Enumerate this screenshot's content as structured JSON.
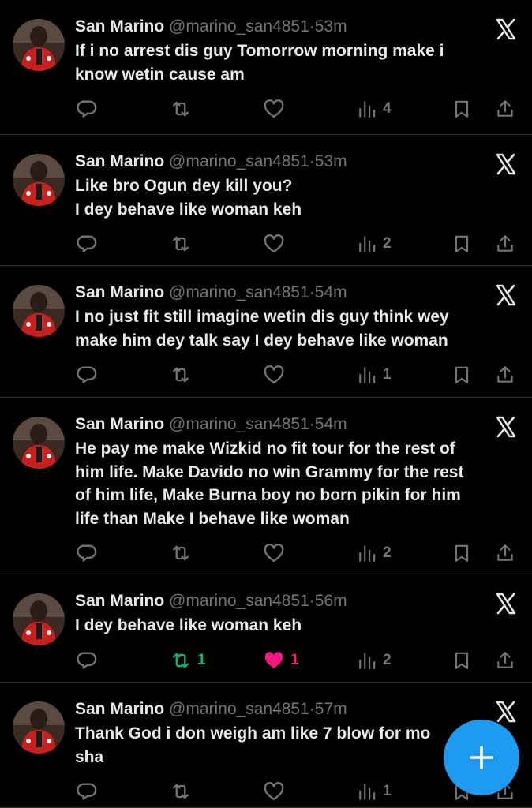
{
  "posts": [
    {
      "name": "San Marino",
      "handle": "@marino_san4851",
      "dot": "·",
      "time": "53m",
      "text": "If i no arrest dis guy Tomorrow morning make i\nknow wetin cause am",
      "reposts": "",
      "likes": "",
      "views": "4",
      "reposted": false,
      "liked": false
    },
    {
      "name": "San Marino",
      "handle": "@marino_san4851",
      "dot": "·",
      "time": "53m",
      "text": "Like bro Ogun dey kill you?\nI dey behave like woman keh",
      "reposts": "",
      "likes": "",
      "views": "2",
      "reposted": false,
      "liked": false
    },
    {
      "name": "San Marino",
      "handle": "@marino_san4851",
      "dot": "·",
      "time": "54m",
      "text": "I no just fit still imagine wetin dis guy think wey\nmake him dey talk say I dey behave like woman",
      "reposts": "",
      "likes": "",
      "views": "1",
      "reposted": false,
      "liked": false
    },
    {
      "name": "San Marino",
      "handle": "@marino_san4851",
      "dot": "·",
      "time": "54m",
      "text": "He pay me make Wizkid no fit tour for the rest of\nhim life. Make Davido no win Grammy for the rest\nof him life, Make Burna boy no born pikin for him\nlife than Make I behave like woman",
      "reposts": "",
      "likes": "",
      "views": "2",
      "reposted": false,
      "liked": false
    },
    {
      "name": "San Marino",
      "handle": "@marino_san4851",
      "dot": "·",
      "time": "56m",
      "text": "I dey behave like woman keh",
      "reposts": "1",
      "likes": "1",
      "views": "2",
      "reposted": true,
      "liked": true
    },
    {
      "name": "San Marino",
      "handle": "@marino_san4851",
      "dot": "·",
      "time": "57m",
      "text": "Thank God i don weigh am like 7 blow for mo\nsha",
      "reposts": "",
      "likes": "",
      "views": "1",
      "reposted": false,
      "liked": false
    }
  ],
  "icons": {
    "reply": "reply-icon",
    "repost": "repost-icon",
    "like": "like-icon",
    "views": "views-icon",
    "bookmark": "bookmark-icon",
    "share": "share-icon",
    "platform": "x-logo-icon",
    "compose": "plus-icon"
  },
  "colors": {
    "accent": "#1d9bf0",
    "repost_active": "#00ba7c",
    "like_active": "#f91880",
    "muted": "#71767b"
  }
}
